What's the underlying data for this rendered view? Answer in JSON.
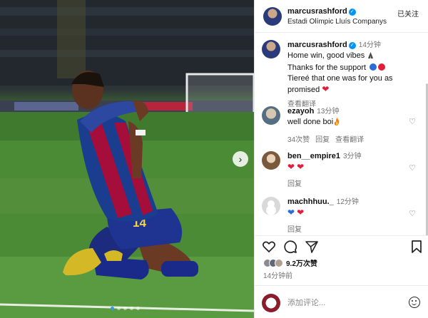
{
  "post": {
    "username": "marcusrashford",
    "location": "Estadi Olímpic Lluís Companys",
    "follow_label": "已关注",
    "caption_time": "14分钟",
    "caption_lines": [
      "Home win, good vibes",
      "Thanks for the support",
      "Tiereé that one was for you as",
      "promised"
    ],
    "caption_translate": "查看翻译",
    "jersey_number": "14",
    "likes": "9.2万次赞",
    "posted_ago": "14分钟前",
    "comment_placeholder": "添加评论..."
  },
  "comments": [
    {
      "user": "ezayoh",
      "time": "13分钟",
      "text": "well done boi",
      "emoji": "fire",
      "likes": "34次赞",
      "reply": "回复",
      "translate": "查看翻译"
    },
    {
      "user": "ben__empire1",
      "time": "3分钟",
      "text": "",
      "emoji": "red-hearts",
      "reply": "回复"
    },
    {
      "user": "machhhuu._",
      "time": "12分钟",
      "text": "",
      "emoji": "blue-red-hearts",
      "reply": "回复"
    }
  ],
  "colors": {
    "verified": "#0095f6",
    "blaugrana_blue": "#1a3d8f",
    "blaugrana_red": "#a50d3a",
    "pitch_green": "#4b8b36"
  },
  "icons": [
    "verified-icon",
    "heart-icon",
    "comment-icon",
    "share-icon",
    "bookmark-icon",
    "emoji-icon",
    "next-arrow-icon",
    "fire-icon",
    "praying-hands-icon"
  ]
}
